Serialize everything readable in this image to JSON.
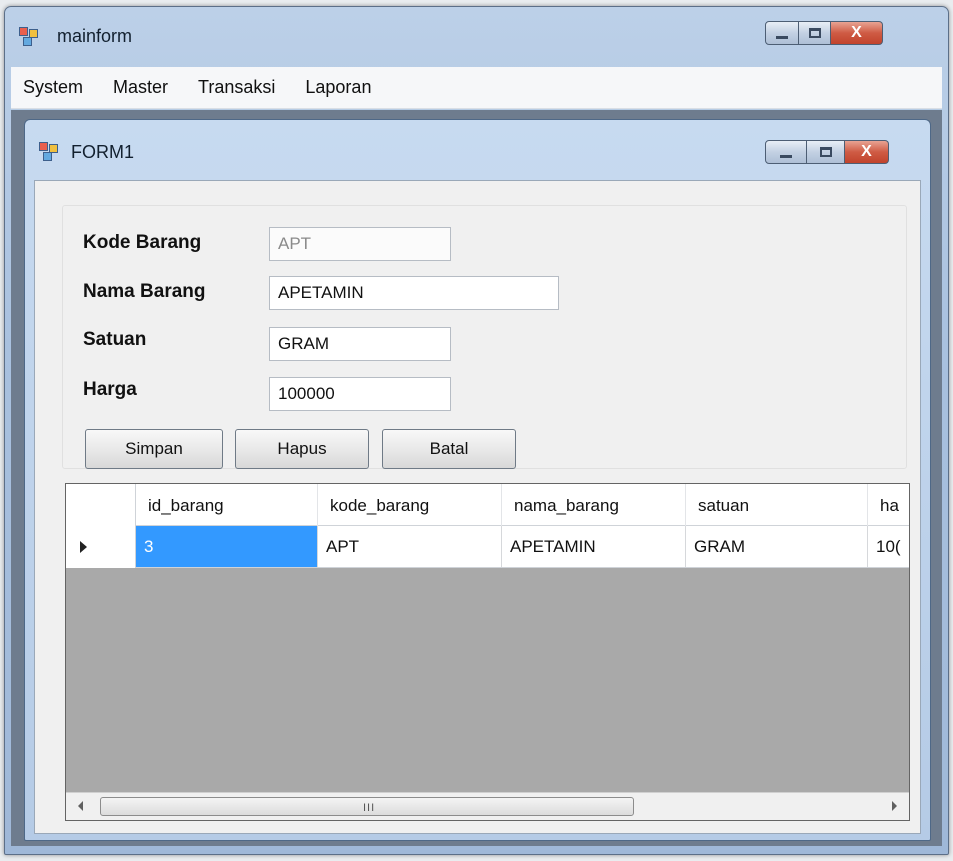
{
  "main_window": {
    "title": "mainform",
    "controls": {
      "minimize": "minimize",
      "maximize": "maximize",
      "close": "X"
    }
  },
  "menu": [
    "System",
    "Master",
    "Transaksi",
    "Laporan"
  ],
  "child_window": {
    "title": "FORM1",
    "controls": {
      "close": "X"
    }
  },
  "form": {
    "kode_label": "Kode Barang",
    "kode_value": "APT",
    "nama_label": "Nama Barang",
    "nama_value": "APETAMIN",
    "satuan_label": "Satuan",
    "satuan_value": "GRAM",
    "harga_label": "Harga",
    "harga_value": "100000"
  },
  "buttons": {
    "simpan": "Simpan",
    "hapus": "Hapus",
    "batal": "Batal"
  },
  "grid": {
    "columns": [
      "id_barang",
      "kode_barang",
      "nama_barang",
      "satuan",
      "ha"
    ],
    "rows": [
      [
        "3",
        "APT",
        "APETAMIN",
        "GRAM",
        "10("
      ]
    ],
    "selected_cell": "id_barang",
    "scroll_grip": "III"
  },
  "colors": {
    "selection": "#3399ff",
    "close_button": "#c1432c",
    "mdi_background": "#6e7c8e"
  },
  "icons": [
    "app-window-icon",
    "minimize-icon",
    "maximize-icon",
    "close-icon",
    "row-pointer-icon",
    "scroll-left-icon",
    "scroll-right-icon"
  ]
}
